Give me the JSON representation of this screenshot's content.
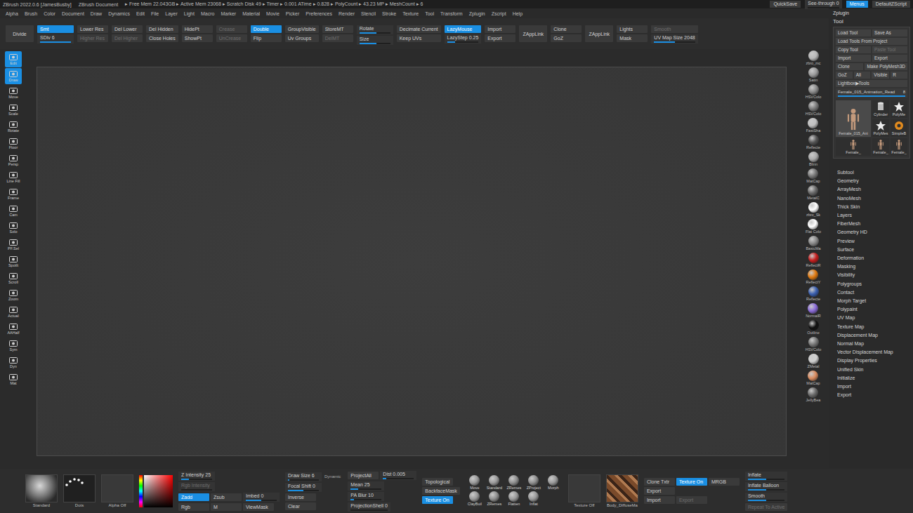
{
  "titlebar": {
    "app": "ZBrush 2022.0.6 [JamesBusby]",
    "document": "ZBrush Document",
    "stats": "▸ Free Mem 22.043GB ▸ Active Mem 23068 ▸ Scratch Disk 49 ▸ Timer ▸ 0.001 ATime ▸ 0.828 ▸ PolyCount ▸ 43.23 MP ▸ MeshCount ▸ 6",
    "quicksave": "QuickSave",
    "seethrough": {
      "label": "See-through",
      "value": "0",
      "level": 0
    },
    "menus": {
      "label": "Menus",
      "on": true
    },
    "script": "DefaultZScript"
  },
  "menu": [
    "Alpha",
    "Brush",
    "Color",
    "Document",
    "Draw",
    "Dynamics",
    "Edit",
    "File",
    "Layer",
    "Light",
    "Macro",
    "Marker",
    "Material",
    "Movie",
    "Picker",
    "Preferences",
    "Render",
    "Stencil",
    "Stroke",
    "Texture",
    "Tool",
    "Transform",
    "Zplugin",
    "Zscript",
    "Help"
  ],
  "top_shelf": [
    {
      "items": [
        {
          "label": "Divide",
          "kind": "big",
          "on": false,
          "disabled": false
        }
      ]
    },
    {
      "items": [
        {
          "label": "Smt",
          "kind": "button",
          "on": true,
          "disabled": false
        },
        {
          "label": "SDiv 6",
          "kind": "slider",
          "on": false,
          "disabled": false,
          "level": 1
        }
      ]
    },
    {
      "items": [
        {
          "label": "Lower Res",
          "kind": "button",
          "on": false,
          "disabled": false
        },
        {
          "label": "Higher Res",
          "kind": "button",
          "on": false,
          "disabled": true
        }
      ]
    },
    {
      "items": [
        {
          "label": "Del Lower",
          "kind": "button",
          "on": false,
          "disabled": false
        },
        {
          "label": "Del Higher",
          "kind": "button",
          "on": false,
          "disabled": true
        }
      ]
    },
    {
      "items": [
        {
          "label": "Del Hidden",
          "kind": "button",
          "on": false,
          "disabled": false
        },
        {
          "label": "Close Holes",
          "kind": "button",
          "on": false,
          "disabled": false
        }
      ]
    },
    {
      "items": [
        {
          "label": "HidePt",
          "kind": "button",
          "on": false,
          "disabled": false
        },
        {
          "label": "ShowPt",
          "kind": "button",
          "on": false,
          "disabled": false
        }
      ]
    },
    {
      "items": [
        {
          "label": "Crease",
          "kind": "button",
          "on": false,
          "disabled": true
        },
        {
          "label": "UnCrease",
          "kind": "button",
          "on": false,
          "disabled": true
        }
      ]
    },
    {
      "items": [
        {
          "label": "Double",
          "kind": "button",
          "on": true,
          "disabled": false
        },
        {
          "label": "Flip",
          "kind": "button",
          "on": false,
          "disabled": false
        }
      ]
    },
    {
      "items": [
        {
          "label": "GroupVisible",
          "kind": "button",
          "on": false,
          "disabled": false
        },
        {
          "label": "Uv Groups",
          "kind": "button",
          "on": false,
          "disabled": false
        }
      ]
    },
    {
      "items": [
        {
          "label": "StoreMT",
          "kind": "button",
          "on": false,
          "disabled": false
        },
        {
          "label": "DelMT",
          "kind": "button",
          "on": false,
          "disabled": true
        }
      ]
    },
    {
      "items": [
        {
          "label": "Rotate",
          "kind": "slider",
          "on": false,
          "disabled": false,
          "level": 0.55
        },
        {
          "label": "Size",
          "kind": "slider",
          "on": false,
          "disabled": false,
          "level": 0.55
        }
      ]
    },
    {
      "items": [
        {
          "label": "Decimate Current",
          "kind": "button",
          "on": false,
          "disabled": false
        },
        {
          "label": "Keep UVs",
          "kind": "button",
          "on": false,
          "disabled": false
        }
      ]
    },
    {
      "items": [
        {
          "label": "LazyMouse",
          "kind": "button",
          "on": true,
          "disabled": false
        },
        {
          "label": "LazyStep 0.25",
          "kind": "slider",
          "on": false,
          "disabled": false,
          "level": 0.25
        }
      ]
    },
    {
      "items": [
        {
          "label": "Import",
          "kind": "button",
          "on": false,
          "disabled": false
        },
        {
          "label": "Export",
          "kind": "button",
          "on": false,
          "disabled": false
        }
      ]
    },
    {
      "items": [
        {
          "label": "ZAppLink",
          "kind": "big",
          "on": false,
          "disabled": false
        }
      ]
    },
    {
      "items": [
        {
          "label": "Clone",
          "kind": "button",
          "on": false,
          "disabled": false
        },
        {
          "label": "GoZ",
          "kind": "button",
          "on": false,
          "disabled": false
        }
      ]
    },
    {
      "items": [
        {
          "label": "ZAppLink",
          "kind": "big",
          "on": false,
          "disabled": false
        }
      ]
    },
    {
      "items": [
        {
          "label": "Lights",
          "kind": "button",
          "on": false,
          "disabled": false
        },
        {
          "label": "Mask",
          "kind": "button",
          "on": false,
          "disabled": false
        }
      ]
    },
    {
      "items": [
        {
          "label": "Smooth",
          "kind": "button",
          "on": false,
          "disabled": true
        },
        {
          "label": "UV Map Size 2048",
          "kind": "slider",
          "on": false,
          "disabled": false,
          "level": 0.5
        }
      ]
    }
  ],
  "left_shelf": [
    {
      "label": "Edit",
      "on": true
    },
    {
      "label": "Draw",
      "on": true
    },
    {
      "label": "Move",
      "on": false
    },
    {
      "label": "Scale",
      "on": false
    },
    {
      "label": "Rotate",
      "on": false
    },
    {
      "label": "Floor",
      "on": false
    },
    {
      "label": "Persp",
      "on": false
    },
    {
      "label": "Line Fill",
      "on": false
    },
    {
      "label": "Frame",
      "on": false
    },
    {
      "label": "Cam",
      "on": false
    },
    {
      "label": "Solo",
      "on": false
    },
    {
      "label": "PF.Sel",
      "on": false
    },
    {
      "label": "Spotlt",
      "on": false
    },
    {
      "label": "Scroll",
      "on": false
    },
    {
      "label": "Zoom",
      "on": false
    },
    {
      "label": "Actual",
      "on": false
    },
    {
      "label": "AAHalf",
      "on": false
    },
    {
      "label": "Sym",
      "on": false
    },
    {
      "label": "Dyn",
      "on": false
    },
    {
      "label": "Mat",
      "on": false
    }
  ],
  "materials": [
    {
      "label": "zbro_mc",
      "color": "#b8b8b8"
    },
    {
      "label": "Satin",
      "color": "#9a9a9a"
    },
    {
      "label": "HSVColo",
      "color": "#8a8a8a"
    },
    {
      "label": "HSVColo",
      "color": "#7a7a7a"
    },
    {
      "label": "FastSha",
      "color": "#c0c0c0"
    },
    {
      "label": "Reflecte",
      "color": "#555555"
    },
    {
      "label": "Blinn",
      "color": "#aaaaaa"
    },
    {
      "label": "MatCap",
      "color": "#777777"
    },
    {
      "label": "MetalC",
      "color": "#6a6a6a"
    },
    {
      "label": "zbro_Sk",
      "color": "#ffffff"
    },
    {
      "label": "Flat Colo",
      "color": "#ffffff"
    },
    {
      "label": "BasicMa",
      "color": "#888888"
    },
    {
      "label": "ReflectR",
      "color": "#c81e1e"
    },
    {
      "label": "ReflectY",
      "color": "#e07a10"
    },
    {
      "label": "Reflecte",
      "color": "#3a5fb0"
    },
    {
      "label": "NormalR",
      "color": "#8a6bd8"
    },
    {
      "label": "Outline",
      "color": "#111111"
    },
    {
      "label": "HSVColo",
      "color": "#777777"
    },
    {
      "label": "ZMetal",
      "color": "#cfcfcf"
    },
    {
      "label": "MatCap",
      "color": "#d98b5f"
    },
    {
      "label": "JellyBea",
      "color": "#6a6a6a"
    }
  ],
  "tool_panel": {
    "zplugin": "Zplugin",
    "title": "Tool",
    "button_rows": [
      [
        {
          "label": "Load Tool",
          "disabled": false
        },
        {
          "label": "Save As",
          "disabled": false
        }
      ],
      [
        {
          "label": "Load Tools From Project",
          "disabled": false
        }
      ],
      [
        {
          "label": "Copy Tool",
          "disabled": false
        },
        {
          "label": "Paste Tool",
          "disabled": true
        }
      ],
      [
        {
          "label": "Import",
          "disabled": false
        },
        {
          "label": "Export",
          "disabled": false
        }
      ],
      [
        {
          "label": "Clone",
          "disabled": false
        },
        {
          "label": "Make PolyMesh3D",
          "disabled": false
        }
      ],
      [
        {
          "label": "GoZ",
          "disabled": false
        },
        {
          "label": "All",
          "disabled": false
        },
        {
          "label": "Visible",
          "disabled": false
        },
        {
          "label": "R",
          "disabled": false
        }
      ],
      [
        {
          "label": "Lightbox▶Tools",
          "disabled": false
        }
      ]
    ],
    "tool_slider": {
      "label": "Female_015_Animation_Read",
      "value": "8",
      "level": 1
    },
    "thumbs": [
      {
        "label": "Female_015_Ani",
        "kind": "figure",
        "selected": true
      },
      {
        "label": "Cylinder",
        "kind": "cylinder",
        "selected": false
      },
      {
        "label": "PolyMe",
        "kind": "star",
        "selected": false
      },
      {
        "label": "PolyMes",
        "kind": "star",
        "selected": false
      },
      {
        "label": "SimpleB",
        "kind": "simple",
        "selected": false
      },
      {
        "label": "Female_",
        "kind": "figure",
        "selected": false
      },
      {
        "label": "Female_",
        "kind": "figure",
        "selected": false
      },
      {
        "label": "Female_",
        "kind": "figure",
        "selected": false
      }
    ],
    "sections": [
      "Subtool",
      "Geometry",
      "ArrayMesh",
      "NanoMesh",
      "Thick Skin",
      "Layers",
      "FiberMesh",
      "Geometry HD",
      "Preview",
      "Surface",
      "Deformation",
      "Masking",
      "Visibility",
      "Polygroups",
      "Contact",
      "Morph Target",
      "Polypaint",
      "UV Map",
      "Texture Map",
      "Displacement Map",
      "Normal Map",
      "Vector Displacement Map",
      "Display Properties",
      "Unified Skin",
      "Initialize",
      "Import",
      "Export"
    ]
  },
  "bottom_shelf": {
    "brush_thumbs": [
      {
        "label": "Standard",
        "kind": "brush"
      },
      {
        "label": "Dots",
        "kind": "stroke"
      },
      {
        "label": "Alpha Off",
        "kind": "alpha"
      }
    ],
    "columns": [
      [
        [
          {
            "label": "Z Intensity 25",
            "kind": "slider",
            "on": false,
            "disabled": false,
            "level": 0.25
          }
        ],
        [
          {
            "label": "Rgb Intensity",
            "kind": "slider",
            "on": false,
            "disabled": true,
            "level": 0
          }
        ],
        [
          {
            "label": "Zadd",
            "kind": "button",
            "on": true,
            "disabled": false
          },
          {
            "label": "Zsub",
            "kind": "button",
            "on": false,
            "disabled": false
          },
          {
            "label": "Imbed 0",
            "kind": "slider",
            "on": false,
            "disabled": false,
            "level": 0.5
          }
        ],
        [
          {
            "label": "Rgb",
            "kind": "button",
            "on": false,
            "disabled": false
          },
          {
            "label": "M",
            "kind": "button",
            "on": false,
            "disabled": false
          },
          {
            "label": "ViewMask",
            "kind": "button",
            "on": false,
            "disabled": false
          }
        ]
      ],
      [
        [
          {
            "label": "Draw Size 6",
            "kind": "slider",
            "on": false,
            "disabled": false,
            "level": 0.05
          },
          {
            "label": "Dynamic",
            "kind": "tag",
            "on": false,
            "disabled": false
          }
        ],
        [
          {
            "label": "Focal Shift 0",
            "kind": "slider",
            "on": false,
            "disabled": false,
            "level": 0.5
          }
        ],
        [
          {
            "label": "Inverse",
            "kind": "button",
            "on": false,
            "disabled": false
          }
        ],
        [
          {
            "label": "Clear",
            "kind": "button",
            "on": false,
            "disabled": false
          }
        ]
      ],
      [
        [
          {
            "label": "ProjectAll",
            "kind": "button",
            "on": false,
            "disabled": false
          },
          {
            "label": "Dist 0.005",
            "kind": "slider",
            "on": false,
            "disabled": false,
            "level": 0.1
          }
        ],
        [
          {
            "label": "Mean 25",
            "kind": "slider",
            "on": false,
            "disabled": false,
            "level": 0.25
          }
        ],
        [
          {
            "label": "PA Blur 10",
            "kind": "slider",
            "on": false,
            "disabled": false,
            "level": 0.1
          }
        ],
        [
          {
            "label": "ProjectionShell 0",
            "kind": "slider",
            "on": false,
            "disabled": false,
            "level": 0
          }
        ]
      ],
      [
        [
          {
            "label": "Topological",
            "kind": "button",
            "on": false,
            "disabled": false
          }
        ],
        [
          {
            "label": "BackfaceMask",
            "kind": "button",
            "on": false,
            "disabled": false
          }
        ],
        [
          {
            "label": "Texture On",
            "kind": "button",
            "on": true,
            "disabled": false
          }
        ]
      ]
    ],
    "brushes": [
      {
        "label": "Move",
        "color": "#9a9a9a"
      },
      {
        "label": "Standard",
        "color": "#9a9a9a"
      },
      {
        "label": "ZRemes",
        "color": "#8f8f8f"
      },
      {
        "label": "ZProject",
        "color": "#8f8f8f"
      },
      {
        "label": "Morph",
        "color": "#9a9a9a"
      },
      {
        "label": "ClayBuil",
        "color": "#9a9a9a"
      },
      {
        "label": "ZRemes",
        "color": "#8f8f8f"
      },
      {
        "label": "Flatten",
        "color": "#9a9a9a"
      },
      {
        "label": "Inflat",
        "color": "#9a9a9a"
      }
    ],
    "textures": [
      {
        "label": "Texture Off",
        "kind": "empty"
      },
      {
        "label": "Body_DiffuseMa",
        "kind": "map"
      }
    ],
    "texture_buttons": [
      [
        {
          "label": "Clone Txtr",
          "kind": "button",
          "on": false,
          "disabled": false
        },
        {
          "label": "Texture On",
          "kind": "button",
          "on": true,
          "disabled": false
        },
        {
          "label": "MRGB",
          "kind": "button",
          "on": false,
          "disabled": false
        }
      ],
      [
        {
          "label": "Export",
          "kind": "button",
          "on": false,
          "disabled": false
        }
      ],
      [
        {
          "label": "Import",
          "kind": "button",
          "on": false,
          "disabled": false
        },
        {
          "label": "Export",
          "kind": "button",
          "on": false,
          "disabled": true
        }
      ]
    ],
    "deform_sliders": [
      {
        "label": "Inflate",
        "kind": "slider",
        "on": false,
        "disabled": false,
        "level": 0.5
      },
      {
        "label": "Inflate Balloon",
        "kind": "slider",
        "on": false,
        "disabled": false,
        "level": 0.5
      },
      {
        "label": "Smooth",
        "kind": "slider",
        "on": false,
        "disabled": false,
        "level": 0.5
      },
      {
        "label": "Repeat To Active",
        "kind": "button",
        "on": false,
        "disabled": true
      }
    ]
  }
}
